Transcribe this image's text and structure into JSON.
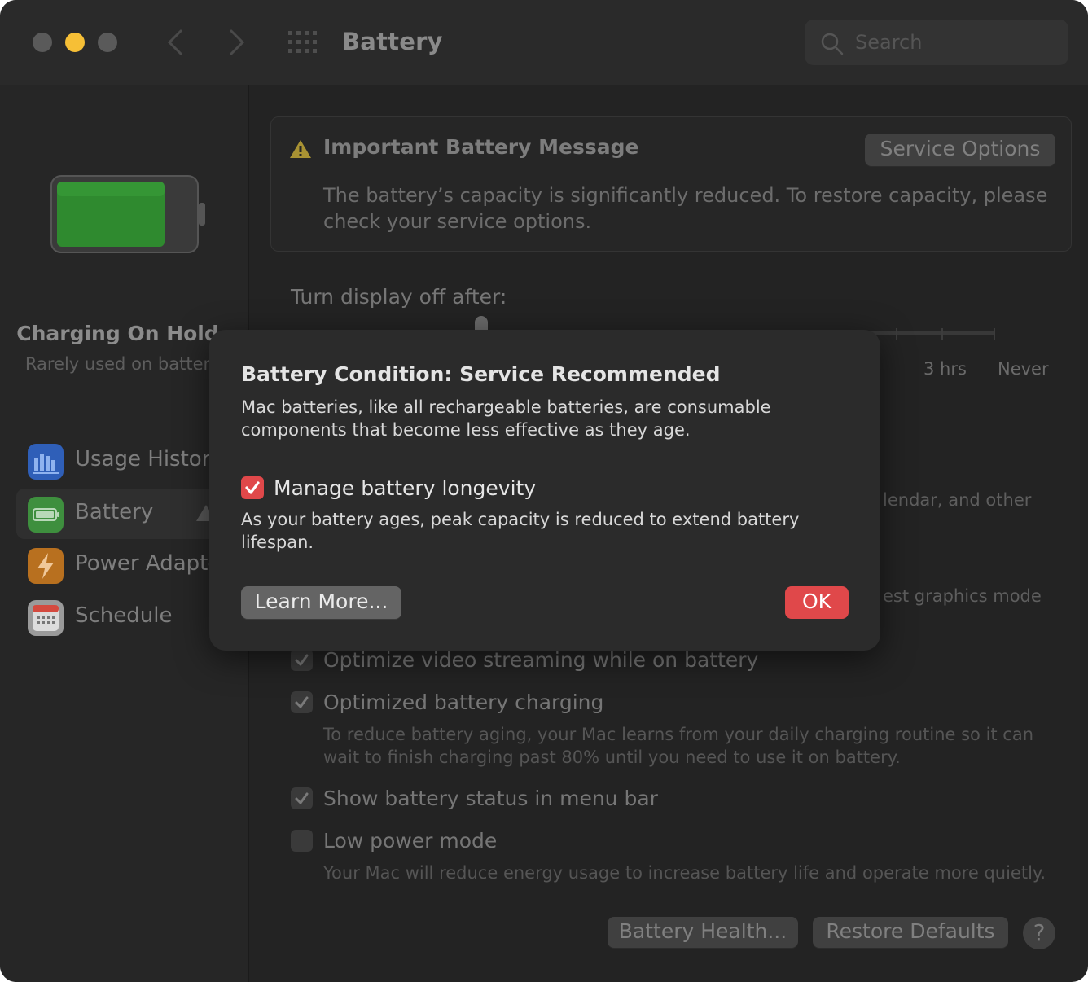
{
  "window": {
    "title": "Battery",
    "search_placeholder": "Search"
  },
  "sidebar": {
    "status_title": "Charging On Hold",
    "status_subtitle": "Rarely used on batter",
    "items": [
      {
        "label": "Usage History",
        "icon": "bar-chart-icon",
        "color": "#3a6fd8"
      },
      {
        "label": "Battery",
        "icon": "battery-icon",
        "color": "#4caf4f",
        "selected": true,
        "warning": true
      },
      {
        "label": "Power Adapte",
        "icon": "lightning-icon",
        "color": "#e08a2b"
      },
      {
        "label": "Schedule",
        "icon": "calendar-icon",
        "color": "#cfcfcf"
      }
    ]
  },
  "message": {
    "title": "Important Battery Message",
    "body": "The battery’s capacity is significantly reduced. To restore capacity, please check your service options.",
    "service_button": "Service Options"
  },
  "display": {
    "label": "Turn display off after:",
    "tick_3hrs": "3 hrs",
    "tick_never": "Never",
    "partial_text_1": "lendar, and other",
    "partial_text_2": "est graphics mode"
  },
  "options": [
    {
      "label": "Optimize video streaming while on battery",
      "checked": true
    },
    {
      "label": "Optimized battery charging",
      "checked": true,
      "description": "To reduce battery aging, your Mac learns from your daily charging routine so it can wait to finish charging past 80% until you need to use it on battery."
    },
    {
      "label": "Show battery status in menu bar",
      "checked": true
    },
    {
      "label": "Low power mode",
      "checked": false,
      "description": "Your Mac will reduce energy usage to increase battery life and operate more quietly."
    }
  ],
  "footer": {
    "battery_health": "Battery Health...",
    "restore_defaults": "Restore Defaults",
    "help": "?"
  },
  "modal": {
    "title": "Battery Condition: Service Recommended",
    "text": "Mac batteries, like all rechargeable batteries, are consumable components that become less effective as they age.",
    "checkbox_label": "Manage battery longevity",
    "checkbox_checked": true,
    "checkbox_desc": "As your battery ages, peak capacity is reduced to extend battery lifespan.",
    "learn_more": "Learn More...",
    "ok": "OK"
  },
  "colors": {
    "accent_red": "#e0484a",
    "battery_green": "#2f8a2f",
    "traffic_yellow": "#f6bf36"
  }
}
